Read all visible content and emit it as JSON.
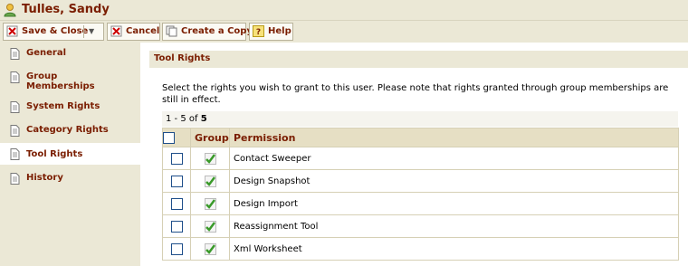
{
  "window": {
    "title": "Tulles, Sandy"
  },
  "toolbar": {
    "save_close_label": "Save & Close",
    "cancel_label": "Cancel",
    "create_copy_label": "Create a Copy",
    "help_label": "Help"
  },
  "sidebar": {
    "items": [
      {
        "label": "General",
        "icon": "page-icon"
      },
      {
        "label": "Group\nMemberships",
        "icon": "page-icon"
      },
      {
        "label": "System Rights",
        "icon": "page-icon"
      },
      {
        "label": "Category Rights",
        "icon": "page-icon"
      },
      {
        "label": "Tool Rights",
        "icon": "page-icon",
        "active": true
      },
      {
        "label": "History",
        "icon": "page-icon"
      }
    ]
  },
  "panel": {
    "title": "Tool Rights",
    "intro": "Select the rights you wish to grant to this user. Please note that rights granted through group memberships are still in effect."
  },
  "pager": {
    "text_prefix": "1 - 5 of ",
    "total": "5"
  },
  "table": {
    "headers": {
      "group": "Group",
      "permission": "Permission"
    },
    "rows": [
      {
        "permission": "Contact Sweeper",
        "group_granted": true
      },
      {
        "permission": "Design Snapshot",
        "group_granted": true
      },
      {
        "permission": "Design Import",
        "group_granted": true
      },
      {
        "permission": "Reassignment Tool",
        "group_granted": true
      },
      {
        "permission": "Xml Worksheet",
        "group_granted": true
      }
    ]
  },
  "colors": {
    "accent": "#7a1d00",
    "chrome": "#ebe8d6",
    "header_row": "#e6dfc4"
  }
}
